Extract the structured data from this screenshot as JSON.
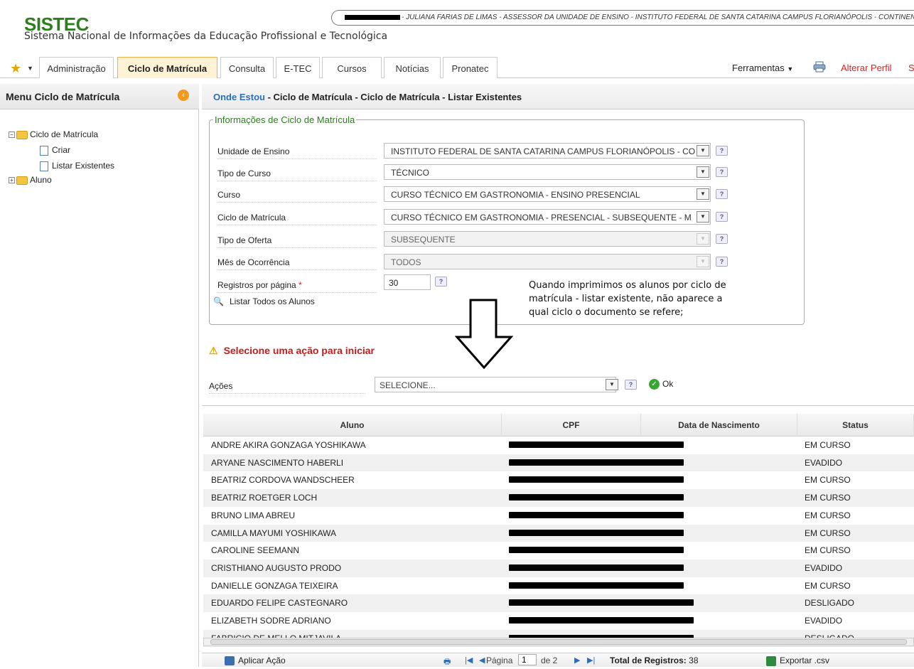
{
  "header": {
    "logo": "SISTEC",
    "subtitle": "Sistema Nacional de Informações da Educação Profissional e Tecnológica",
    "user_info": "- JULIANA FARIAS DE LIMAS - ASSESSOR DA UNIDADE DE ENSINO - INSTITUTO FEDERAL DE SANTA CATARINA CAMPUS FLORIANÓPOLIS - CONTINEN"
  },
  "tabs": [
    {
      "label": "Administração"
    },
    {
      "label": "Ciclo de Matrícula"
    },
    {
      "label": "Consulta"
    },
    {
      "label": "E-TEC"
    },
    {
      "label": "Cursos"
    },
    {
      "label": "Notícias"
    },
    {
      "label": "Pronatec"
    }
  ],
  "topright": {
    "tools": "Ferramentas",
    "alterar": "Alterar Perfil",
    "sair": "S"
  },
  "sidebar": {
    "title": "Menu Ciclo de Matrícula",
    "tree": {
      "root": "Ciclo de Matrícula",
      "criar": "Criar",
      "listar": "Listar Existentes",
      "aluno": "Aluno"
    }
  },
  "breadcrumb": {
    "where": "Onde Estou",
    "path": " - Ciclo de Matrícula - Ciclo de Matrícula - Listar Existentes"
  },
  "form": {
    "legend": "Informações de Ciclo de Matrícula",
    "unidade_label": "Unidade de Ensino",
    "unidade_value": "INSTITUTO FEDERAL DE SANTA CATARINA CAMPUS FLORIANÓPOLIS - CO",
    "tipo_curso_label": "Tipo de Curso",
    "tipo_curso_value": "TÉCNICO",
    "curso_label": "Curso",
    "curso_value": "CURSO TÉCNICO EM GASTRONOMIA - ENSINO PRESENCIAL",
    "ciclo_label": "Ciclo de Matrícula",
    "ciclo_value": "CURSO TÉCNICO EM GASTRONOMIA - PRESENCIAL - SUBSEQUENTE - M",
    "oferta_label": "Tipo de Oferta",
    "oferta_value": "SUBSEQUENTE",
    "mes_label": "Mês de Ocorrência",
    "mes_value": "TODOS",
    "registros_label": "Registros por página",
    "registros_required": "*",
    "registros_value": "30",
    "listar_todos": "Listar Todos os Alunos",
    "note": "Quando imprimimos os alunos por ciclo de matrícula - listar existente, não aparece a qual ciclo o documento se refere;"
  },
  "actions": {
    "warning": "Selecione uma ação para iniciar",
    "label": "Ações",
    "select_value": "SELECIONE...",
    "ok": "Ok"
  },
  "grid": {
    "columns": [
      "Aluno",
      "CPF",
      "Data de Nascimento",
      "Status"
    ],
    "rows": [
      {
        "aluno": "ANDRE AKIRA GONZAGA YOSHIKAWA",
        "status": "EM CURSO"
      },
      {
        "aluno": "ARYANE NASCIMENTO HABERLI",
        "status": "EVADIDO"
      },
      {
        "aluno": "BEATRIZ CORDOVA WANDSCHEER",
        "status": "EM CURSO"
      },
      {
        "aluno": "BEATRIZ ROETGER LOCH",
        "status": "EM CURSO"
      },
      {
        "aluno": "BRUNO LIMA ABREU",
        "status": "EM CURSO"
      },
      {
        "aluno": "CAMILLA MAYUMI YOSHIKAWA",
        "status": "EM CURSO"
      },
      {
        "aluno": "CAROLINE SEEMANN",
        "status": "EM CURSO"
      },
      {
        "aluno": "CRISTHIANO AUGUSTO PRODO",
        "status": "EVADIDO"
      },
      {
        "aluno": "DANIELLE GONZAGA TEIXEIRA",
        "status": "EM CURSO"
      },
      {
        "aluno": "EDUARDO FELIPE CASTEGNARO",
        "status": "DESLIGADO"
      },
      {
        "aluno": "ELIZABETH SODRE ADRIANO",
        "status": "EVADIDO"
      },
      {
        "aluno": "FABRICIO DE MELLO MITJAVILA",
        "status": "DESLIGADO"
      }
    ]
  },
  "footer": {
    "aplicar": "Aplicar Ação",
    "pagina": "Página",
    "page_value": "1",
    "de": "de 2",
    "total_label": "Total de Registros:",
    "total_value": "38",
    "exportar": "Exportar .csv"
  }
}
